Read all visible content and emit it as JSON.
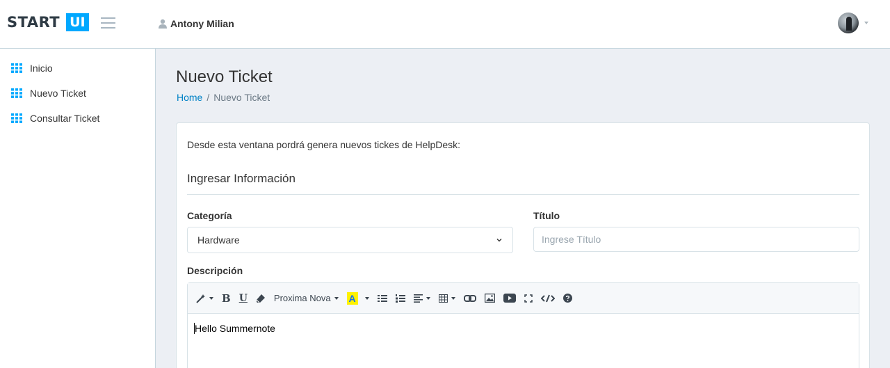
{
  "header": {
    "logo_text": "START",
    "logo_badge": "UI",
    "user_name": "Antony Milian"
  },
  "sidebar": {
    "items": [
      {
        "label": "Inicio",
        "icon": "grid-icon"
      },
      {
        "label": "Nuevo Ticket",
        "icon": "grid-icon"
      },
      {
        "label": "Consultar Ticket",
        "icon": "grid-icon"
      }
    ]
  },
  "page": {
    "title": "Nuevo Ticket",
    "breadcrumb": {
      "home": "Home",
      "separator": "/",
      "current": "Nuevo Ticket"
    }
  },
  "form": {
    "intro": "Desde esta ventana pordrá genera nuevos tickes de HelpDesk:",
    "section_title": "Ingresar Información",
    "category_label": "Categoría",
    "category_value": "Hardware",
    "title_label": "Título",
    "title_placeholder": "Ingrese Título",
    "description_label": "Descripción",
    "editor": {
      "font_name": "Proxima Nova",
      "bold_glyph": "B",
      "underline_glyph": "U",
      "color_glyph": "A",
      "content": "Hello Summernote"
    }
  },
  "colors": {
    "accent": "#00a8ff",
    "link": "#0082c6",
    "background": "#eceff4",
    "highlight": "#fff200"
  }
}
